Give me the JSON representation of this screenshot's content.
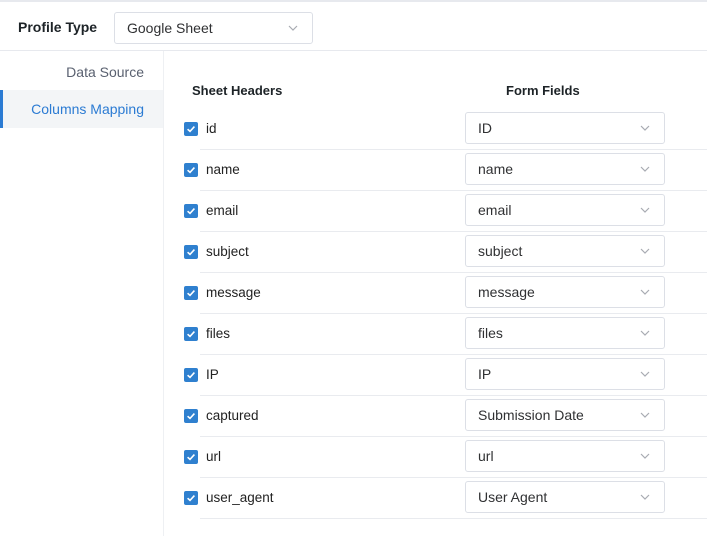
{
  "profile": {
    "label": "Profile Type",
    "selected": "Google Sheet"
  },
  "sidebar": {
    "items": [
      {
        "label": "Data Source",
        "active": false
      },
      {
        "label": "Columns Mapping",
        "active": true
      }
    ]
  },
  "mapping": {
    "headers": {
      "sheet": "Sheet Headers",
      "form": "Form Fields"
    },
    "rows": [
      {
        "sheet_header": "id",
        "checked": true,
        "form_field": "ID"
      },
      {
        "sheet_header": "name",
        "checked": true,
        "form_field": "name"
      },
      {
        "sheet_header": "email",
        "checked": true,
        "form_field": "email"
      },
      {
        "sheet_header": "subject",
        "checked": true,
        "form_field": "subject"
      },
      {
        "sheet_header": "message",
        "checked": true,
        "form_field": "message"
      },
      {
        "sheet_header": "files",
        "checked": true,
        "form_field": "files"
      },
      {
        "sheet_header": "IP",
        "checked": true,
        "form_field": "IP"
      },
      {
        "sheet_header": "captured",
        "checked": true,
        "form_field": "Submission Date"
      },
      {
        "sheet_header": "url",
        "checked": true,
        "form_field": "url"
      },
      {
        "sheet_header": "user_agent",
        "checked": true,
        "form_field": "User Agent"
      }
    ]
  },
  "colors": {
    "accent": "#2b7bd3",
    "checkbox": "#2f80cf"
  }
}
